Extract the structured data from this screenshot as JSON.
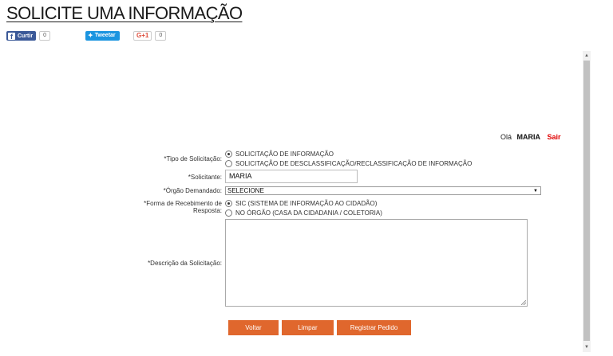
{
  "page": {
    "title": "SOLICITE UMA INFORMAÇÃO"
  },
  "share": {
    "facebook_label": "Curtir",
    "facebook_count": "0",
    "twitter_label": "Tweetar",
    "gplus_label": "G+1",
    "gplus_count": "0"
  },
  "user": {
    "greeting": "Olá",
    "name": "MARIA",
    "logout": "Sair"
  },
  "form": {
    "tipo_label": "*Tipo de Solicitação:",
    "tipo_options": [
      {
        "label": "SOLICITAÇÃO DE INFORMAÇÃO",
        "selected": true
      },
      {
        "label": "SOLICITAÇÃO DE DESCLASSIFICAÇÃO/RECLASSIFICAÇÃO DE INFORMAÇÃO",
        "selected": false
      }
    ],
    "solicitante_label": "*Solicitante:",
    "solicitante_value": "MARIA",
    "orgao_label": "*Órgão Demandado:",
    "orgao_value": "SELECIONE",
    "forma_label_1": "*Forma de Recebimento de",
    "forma_label_2": "Resposta:",
    "forma_options": [
      {
        "label": "SIC (SISTEMA DE INFORMAÇÃO AO CIDADÃO)",
        "selected": true
      },
      {
        "label": "NO ÓRGÃO (CASA DA CIDADANIA / COLETORIA)",
        "selected": false
      }
    ],
    "descricao_label": "*Descrição da Solicitação:",
    "descricao_value": ""
  },
  "buttons": {
    "voltar": "Voltar",
    "limpar": "Limpar",
    "registrar": "Registrar Pedido"
  },
  "colors": {
    "accent": "#e0672d",
    "logout": "#e00000",
    "facebook": "#3b5998",
    "twitter": "#1b95e0"
  },
  "icons": {
    "facebook": "facebook-icon",
    "twitter": "twitter-bird-icon",
    "select": "chevron-down-icon"
  }
}
